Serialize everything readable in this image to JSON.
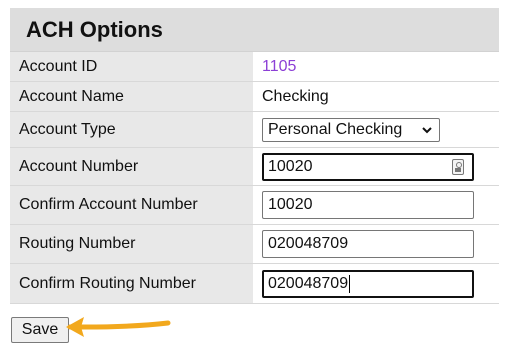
{
  "panel": {
    "title": "ACH Options"
  },
  "rows": {
    "account_id": {
      "label": "Account ID",
      "value": "1105"
    },
    "account_name": {
      "label": "Account Name",
      "value": "Checking"
    },
    "account_type": {
      "label": "Account Type",
      "value": "Personal Checking"
    },
    "account_number": {
      "label": "Account Number",
      "value": "10020"
    },
    "confirm_account_number": {
      "label": "Confirm Account Number",
      "value": "10020"
    },
    "routing_number": {
      "label": "Routing Number",
      "value": "020048709"
    },
    "confirm_routing_number": {
      "label": "Confirm Routing Number",
      "value": "020048709"
    }
  },
  "actions": {
    "save_label": "Save"
  },
  "icons": {
    "dropdown": "chevron-down-icon",
    "password_manager": "key-icon",
    "annotation": "arrow-left-icon"
  },
  "colors": {
    "link": "#8c3fd6",
    "header_bg": "#dddddd",
    "label_bg": "#e8e8e8",
    "arrow": "#f2a81d"
  }
}
